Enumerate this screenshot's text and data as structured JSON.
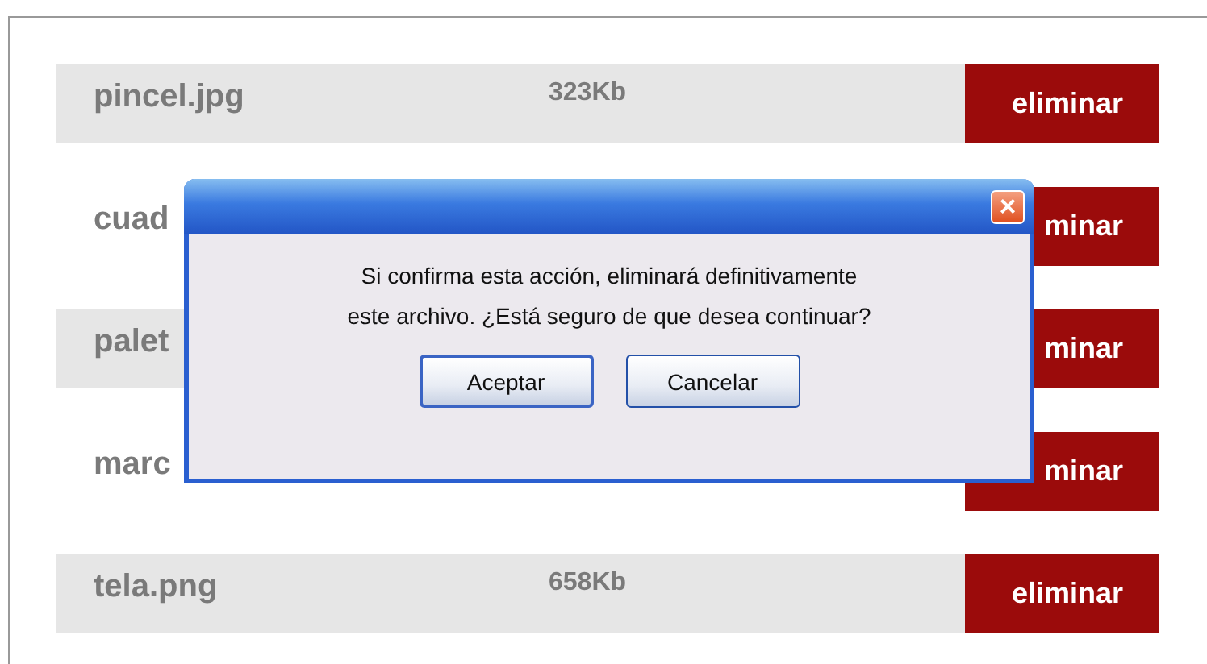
{
  "files": [
    {
      "name": "pincel.jpg",
      "size": "323Kb",
      "action": "eliminar"
    },
    {
      "name": "cuad",
      "action": "minar"
    },
    {
      "name": "palet",
      "action": "minar"
    },
    {
      "name": "marc",
      "action": "minar"
    },
    {
      "name": "tela.png",
      "size": "658Kb",
      "action": "eliminar"
    }
  ],
  "dialog": {
    "close": "×",
    "message_lines": [
      "Si confirma esta acción, eliminará definitivamente",
      "este archivo. ¿Está seguro de que desea continuar?"
    ],
    "buttons": [
      {
        "label": "Aceptar",
        "selected": true
      },
      {
        "label": "Cancelar",
        "selected": false
      }
    ]
  }
}
